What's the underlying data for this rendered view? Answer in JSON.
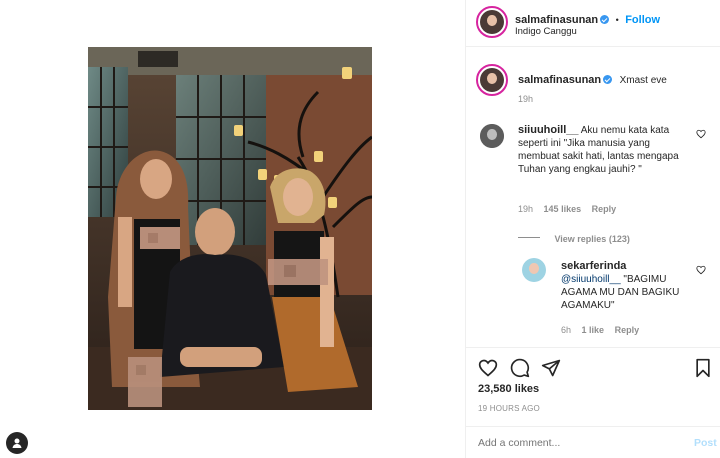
{
  "post": {
    "username": "salmafinasunan",
    "follow_label": "Follow",
    "follow_separator": "•",
    "location": "Indigo Canggu",
    "caption": "Xmast eve",
    "caption_time": "19h",
    "likes": "23,580 likes",
    "date": "19 HOURS AGO"
  },
  "comments": [
    {
      "username": "siiuuhoill__",
      "text": "Aku nemu kata kata seperti ini \"Jika manusia yang membuat sakit hati, lantas mengapa Tuhan yang engkau jauhi? \"",
      "time": "19h",
      "likes": "145 likes",
      "reply_label": "Reply",
      "view_replies": "View replies (123)"
    },
    {
      "username": "sekarferinda",
      "mention": "@siiuuhoill__",
      "text": " \"BAGIMU AGAMA MU DAN BAGIKU AGAMAKU\"",
      "time": "6h",
      "likes": "1 like",
      "reply_label": "Reply"
    }
  ],
  "comment_input": {
    "placeholder": "Add a comment...",
    "post_label": "Post"
  },
  "icons": [
    "heart-icon",
    "comment-icon",
    "share-icon",
    "bookmark-icon",
    "profile-icon"
  ],
  "colors": {
    "accent": "#0095f6",
    "verified": "#3897f0",
    "muted": "#8e8e8e",
    "post_disabled": "#b2dffc"
  }
}
